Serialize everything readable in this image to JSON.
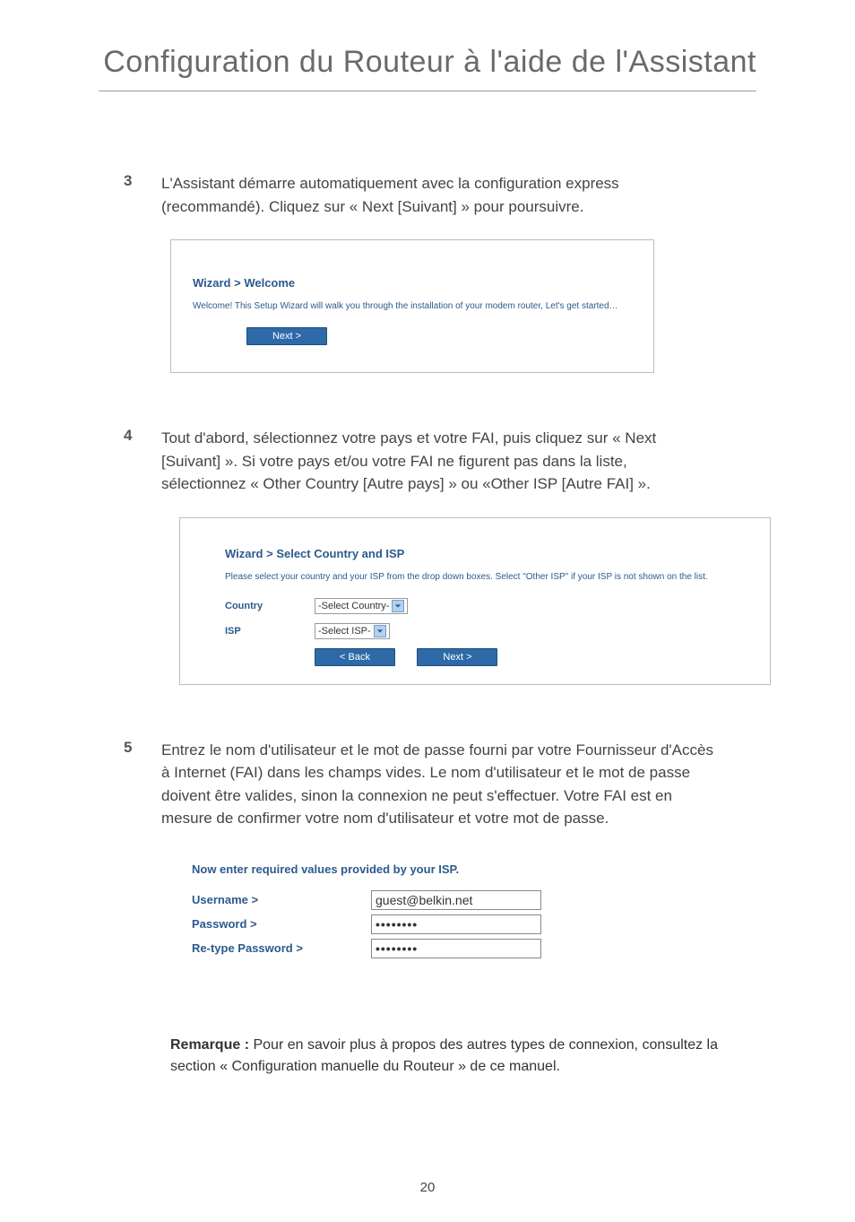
{
  "title": "Configuration du Routeur à l'aide de l'Assistant",
  "steps": {
    "s3": {
      "num": "3",
      "text": "L'Assistant démarre automatiquement avec la configuration express (recommandé). Cliquez sur « Next [Suivant] » pour poursuivre."
    },
    "s4": {
      "num": "4",
      "text": "Tout d'abord, sélectionnez votre pays et votre FAI, puis cliquez sur « Next [Suivant] ». Si votre pays et/ou votre FAI ne figurent pas dans la liste, sélectionnez « Other Country [Autre pays] » ou «Other ISP [Autre FAI] »."
    },
    "s5": {
      "num": "5",
      "text": "Entrez le nom d'utilisateur et le mot de passe fourni par votre Fournisseur d'Accès à Internet (FAI) dans les champs vides. Le nom d'utilisateur et le mot de passe doivent être valides, sinon la connexion ne peut s'effectuer. Votre FAI est en mesure de confirmer votre nom d'utilisateur et votre mot de passe."
    }
  },
  "wizard1": {
    "title": "Wizard > Welcome",
    "desc": "Welcome! This Setup Wizard will walk you through the installation of your modem router, Let's get started…",
    "next": "Next >"
  },
  "wizard2": {
    "title": "Wizard > Select Country and ISP",
    "desc": "Please select your country and your ISP from the drop down boxes. Select \"Other ISP\" if your ISP is not shown on the list.",
    "countryLabel": "Country",
    "ispLabel": "ISP",
    "countryValue": "-Select Country-",
    "ispValue": "-Select ISP-",
    "back": "< Back",
    "next": "Next >"
  },
  "wizard3": {
    "title": "Now enter required values provided by your ISP.",
    "usernameLabel": "Username >",
    "passwordLabel": "Password >",
    "retypeLabel": "Re-type Password >",
    "usernameValue": "guest@belkin.net",
    "passwordValue": "••••••••",
    "retypeValue": "••••••••"
  },
  "remark": {
    "bold": "Remarque :",
    "text": " Pour en savoir plus à propos des autres types de connexion, consultez la section « Configuration manuelle du Routeur » de ce manuel."
  },
  "pageNumber": "20"
}
